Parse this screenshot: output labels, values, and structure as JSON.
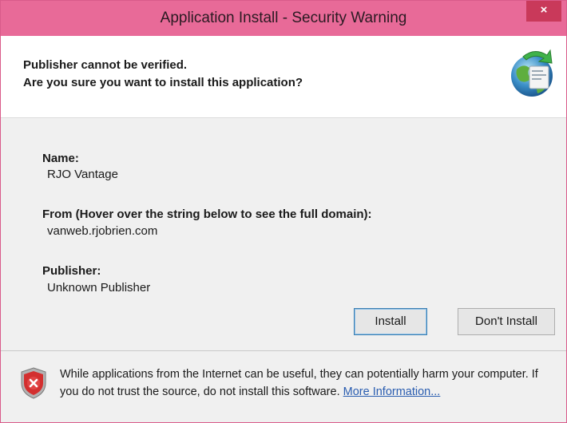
{
  "window": {
    "title": "Application Install - Security Warning",
    "close_label": "×"
  },
  "header": {
    "line1": "Publisher cannot be verified.",
    "line2": "Are you sure you want to install this application?",
    "icon": "globe-install-icon"
  },
  "details": {
    "name_label": "Name:",
    "name_value": "RJO Vantage",
    "from_label": "From (Hover over the string below to see the full domain):",
    "from_value": "vanweb.rjobrien.com",
    "publisher_label": "Publisher:",
    "publisher_value": "Unknown Publisher"
  },
  "buttons": {
    "install": "Install",
    "dont_install": "Don't Install"
  },
  "footer": {
    "warning_text": "While applications from the Internet can be useful, they can potentially harm your computer. If you do not trust the source, do not install this software.",
    "link_text": "More Information...",
    "icon": "shield-warning-icon"
  },
  "colors": {
    "titlebar": "#e86a98",
    "close_button": "#c9395a",
    "link": "#2a5db0"
  }
}
